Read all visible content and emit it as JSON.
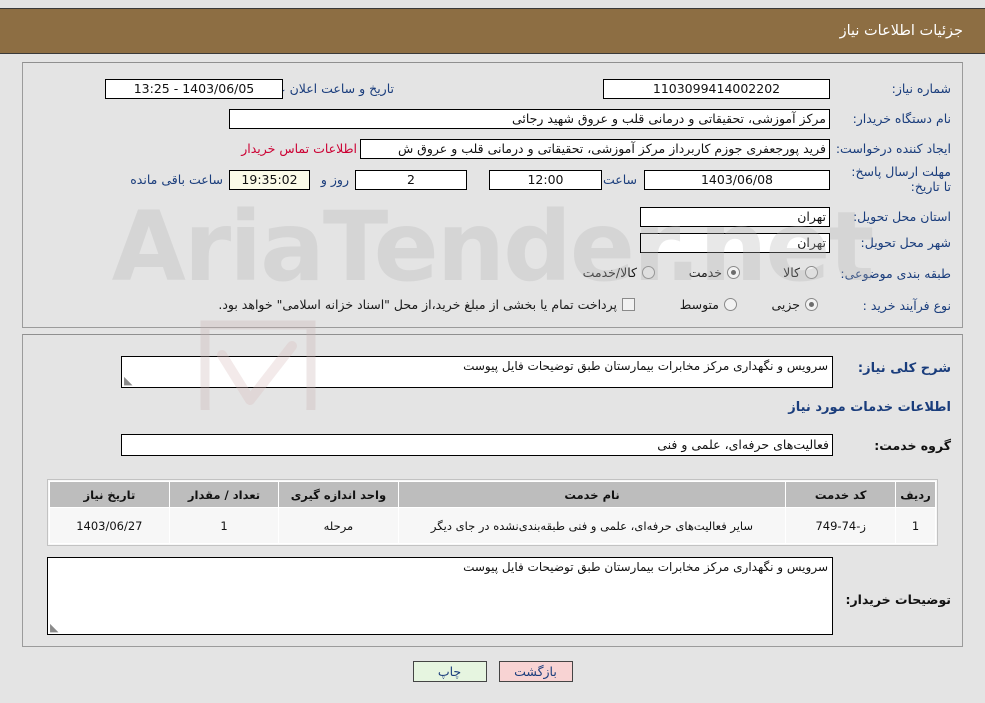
{
  "header": {
    "title": "جزئیات اطلاعات نیاز"
  },
  "fields": {
    "need_number_label": "شماره نیاز:",
    "need_number_value": "1103099414002202",
    "buyer_org_label": "نام دستگاه خریدار:",
    "buyer_org_value": "مرکز آموزشی، تحقیقاتی و درمانی قلب و عروق شهید رجائی",
    "creator_label": "ایجاد کننده درخواست:",
    "creator_value": "فرید پورجعفری جوزم کاربرداز  مرکز آموزشی، تحقیقاتی و درمانی قلب و عروق ش",
    "contact_link": "اطلاعات تماس خریدار",
    "deadline_label": "مهلت ارسال پاسخ: تا تاریخ:",
    "deadline_date": "1403/06/08",
    "time_label": "ساعت",
    "deadline_time": "12:00",
    "days_value": "2",
    "days_suffix": "روز و",
    "countdown_value": "19:35:02",
    "countdown_suffix": "ساعت باقی مانده",
    "announce_label": "تاریخ و ساعت اعلان عمومی:",
    "announce_value": "1403/06/05 - 13:25",
    "province_label": "استان محل تحویل:",
    "province_value": "تهران",
    "city_label": "شهر محل تحویل:",
    "city_value": "تهران",
    "category_label": "طبقه بندی موضوعی:",
    "category_options": [
      {
        "label": "کالا",
        "selected": false
      },
      {
        "label": "خدمت",
        "selected": true
      },
      {
        "label": "کالا/خدمت",
        "selected": false
      }
    ],
    "process_label": "نوع فرآیند خرید :",
    "process_options": [
      {
        "label": "جزیی",
        "selected": true
      },
      {
        "label": "متوسط",
        "selected": false
      }
    ],
    "treasury_checkbox_text": "پرداخت تمام یا بخشی از مبلغ خرید،از محل \"اسناد خزانه اسلامی\" خواهد بود.",
    "treasury_checked": false
  },
  "summary": {
    "label": "شرح کلی نیاز:",
    "value": "سرویس و نگهداری مرکز مخابرات بیمارستان طبق توضیحات فایل پیوست"
  },
  "services_section": {
    "heading": "اطلاعات خدمات مورد نیاز",
    "group_label": "گروه خدمت:",
    "group_value": "فعالیت‌های حرفه‌ای، علمی و فنی"
  },
  "table": {
    "columns": [
      "ردیف",
      "کد خدمت",
      "نام خدمت",
      "واحد اندازه گیری",
      "تعداد / مقدار",
      "تاریخ نیاز"
    ],
    "rows": [
      {
        "radif": "1",
        "code": "ز-74-749",
        "name": "سایر فعالیت‌های حرفه‌ای، علمی و فنی طبقه‌بندی‌نشده در جای دیگر",
        "unit": "مرحله",
        "qty": "1",
        "date": "1403/06/27"
      }
    ]
  },
  "buyer_notes": {
    "label": "توضیحات خریدار:",
    "value": "سرویس و نگهداری مرکز مخابرات بیمارستان طبق توضیحات فایل پیوست"
  },
  "buttons": {
    "print": "چاپ",
    "back": "بازگشت"
  },
  "watermark": {
    "text": "AriaTender.net"
  },
  "colors": {
    "title_bar": "#8d6e43",
    "label_blue": "#1a3d7c",
    "link_red": "#cc0033",
    "page_bg": "#e4e4e4",
    "back_btn": "#f8d3d3",
    "print_btn": "#e6f5e0",
    "countdown_bg": "#fbfbe8"
  }
}
